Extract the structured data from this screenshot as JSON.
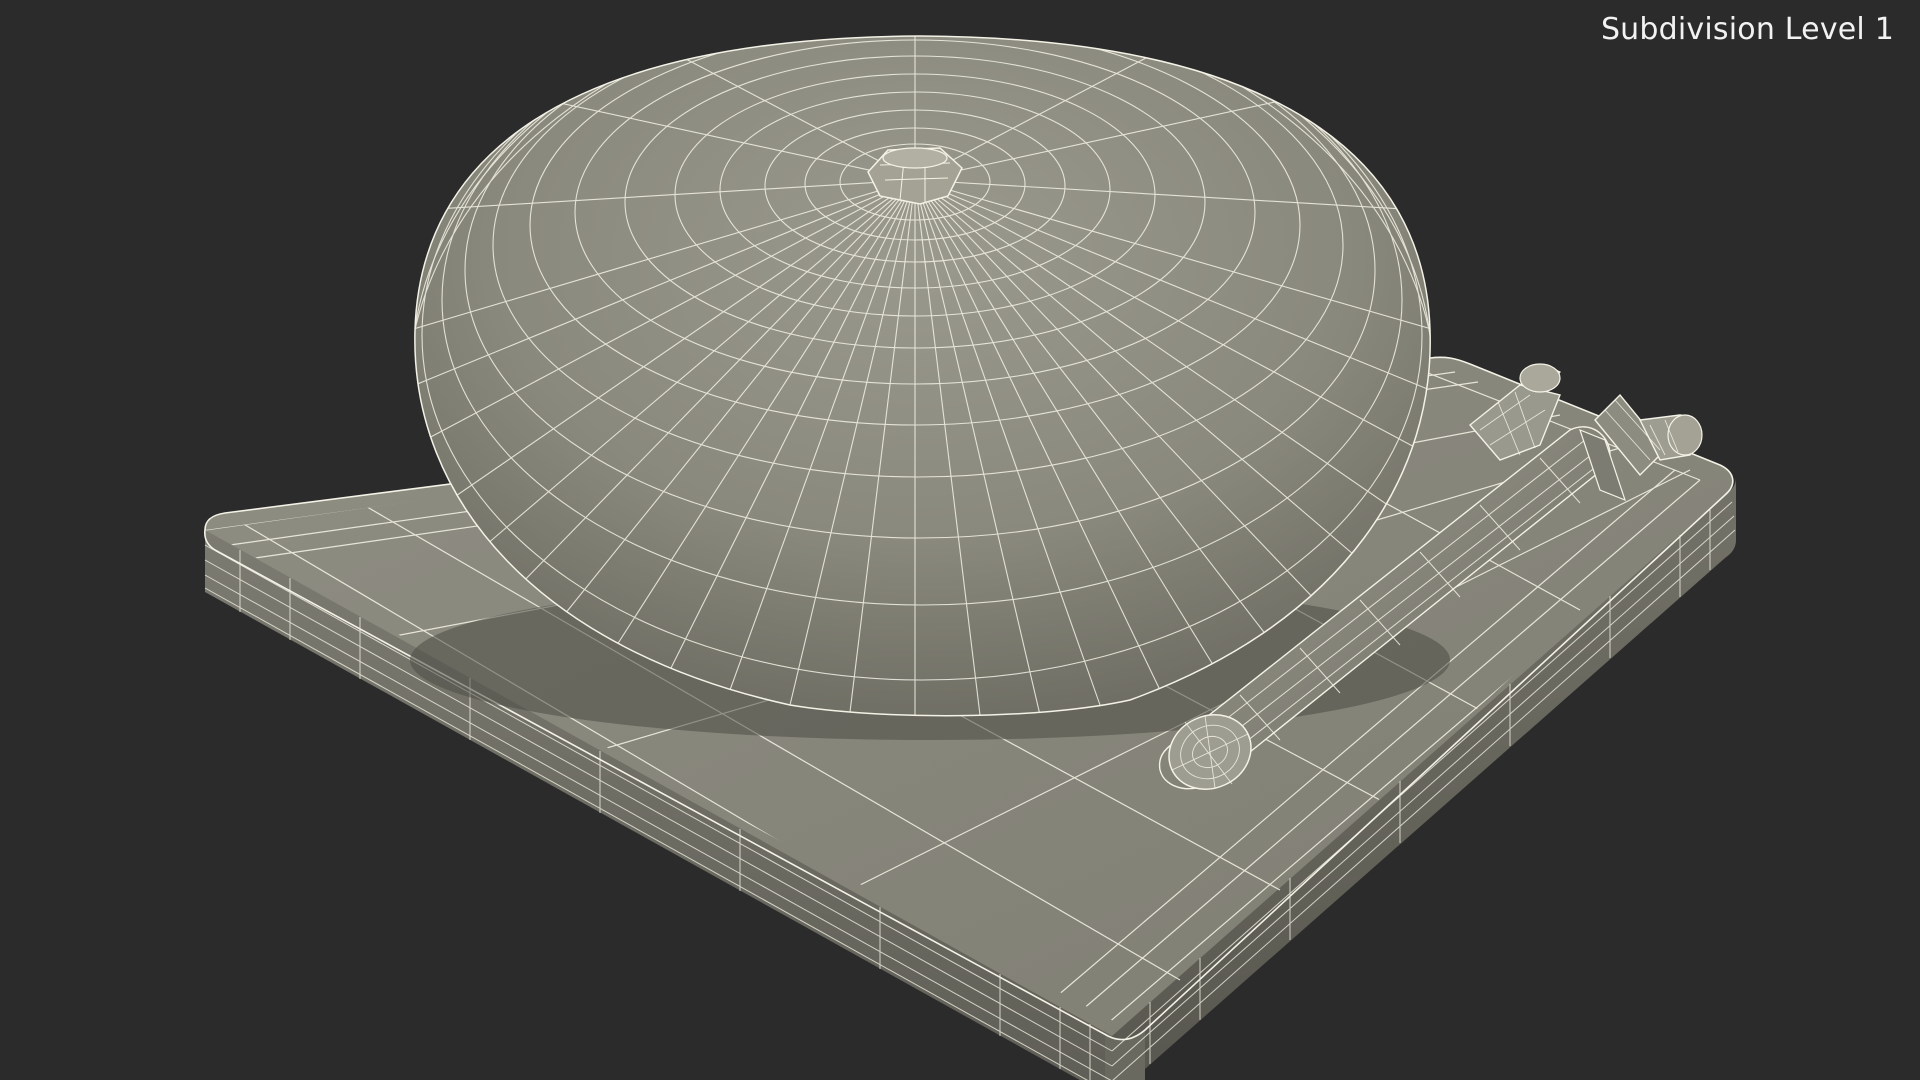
{
  "viewport": {
    "label": "Subdivision Level 1",
    "background": "#2b2b2b",
    "mesh_fill": "#8b8a7e",
    "mesh_shadow": "#6f6e64",
    "wire_color": "#f4f2e6"
  },
  "scene": {
    "objects": [
      "base-plate",
      "bell-dome",
      "center-nut",
      "striker-arm",
      "striker-bracket"
    ]
  }
}
